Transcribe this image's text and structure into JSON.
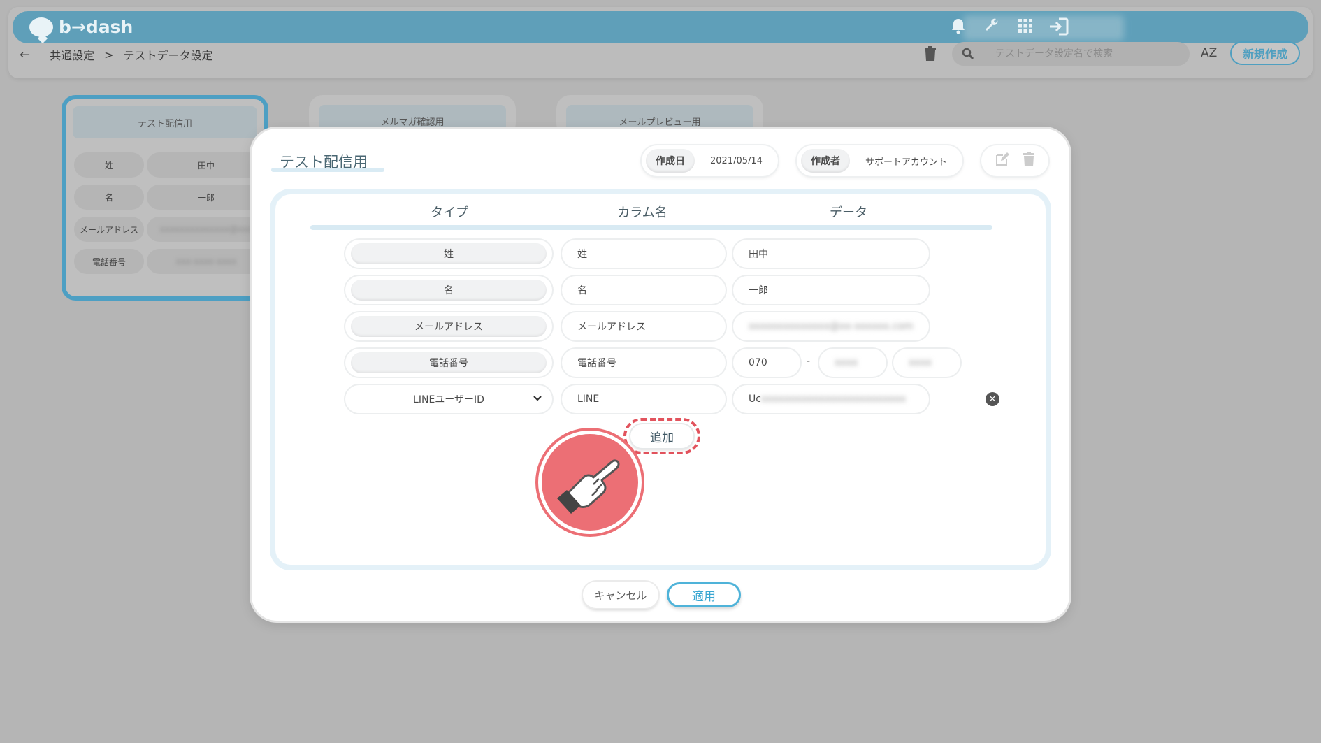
{
  "header": {
    "brand": "b→dash",
    "icons": [
      "bell-icon",
      "wrench-icon",
      "grid-icon",
      "login-icon"
    ]
  },
  "breadcrumb": {
    "items": [
      "共通設定",
      ">",
      "テストデータ設定"
    ]
  },
  "toolbar": {
    "search_placeholder": "テストデータ設定名で検索",
    "sort_label": "AZ",
    "new_button": "新規作成"
  },
  "cards": [
    {
      "title": "テスト配信用",
      "rows": [
        {
          "label": "姓",
          "value": "田中"
        },
        {
          "label": "名",
          "value": "一郎"
        },
        {
          "label": "メールアドレス",
          "value": "xxxxxxxxxxxxxx@xxx"
        },
        {
          "label": "電話番号",
          "value": "xxx-xxxx-xxxx"
        }
      ]
    },
    {
      "title": "メルマガ確認用"
    },
    {
      "title": "メールプレビュー用"
    }
  ],
  "modal": {
    "title": "テスト配信用",
    "created_date_label": "作成日",
    "created_date": "2021/05/14",
    "author_label": "作成者",
    "author": "サポートアカウント",
    "columns": {
      "type": "タイプ",
      "column_name": "カラム名",
      "data": "データ"
    },
    "rows": [
      {
        "type": "姓",
        "column": "姓",
        "data": "田中"
      },
      {
        "type": "名",
        "column": "名",
        "data": "一郎"
      },
      {
        "type": "メールアドレス",
        "column": "メールアドレス",
        "data": "xxxxxxxxxxxxxx@xx-xxxxxx.com"
      },
      {
        "type": "電話番号",
        "column": "電話番号",
        "phone1": "070",
        "phone_sep": "-",
        "phone2": "xxxx",
        "phone3": "xxxx"
      },
      {
        "type": "LINEユーザーID",
        "column": "LINE",
        "data_prefix": "Uc",
        "data": "xxxxxxxxxxxxxxxxxxxxxxxxx"
      }
    ],
    "add_button": "追加",
    "cancel_button": "キャンセル",
    "apply_button": "適用"
  }
}
